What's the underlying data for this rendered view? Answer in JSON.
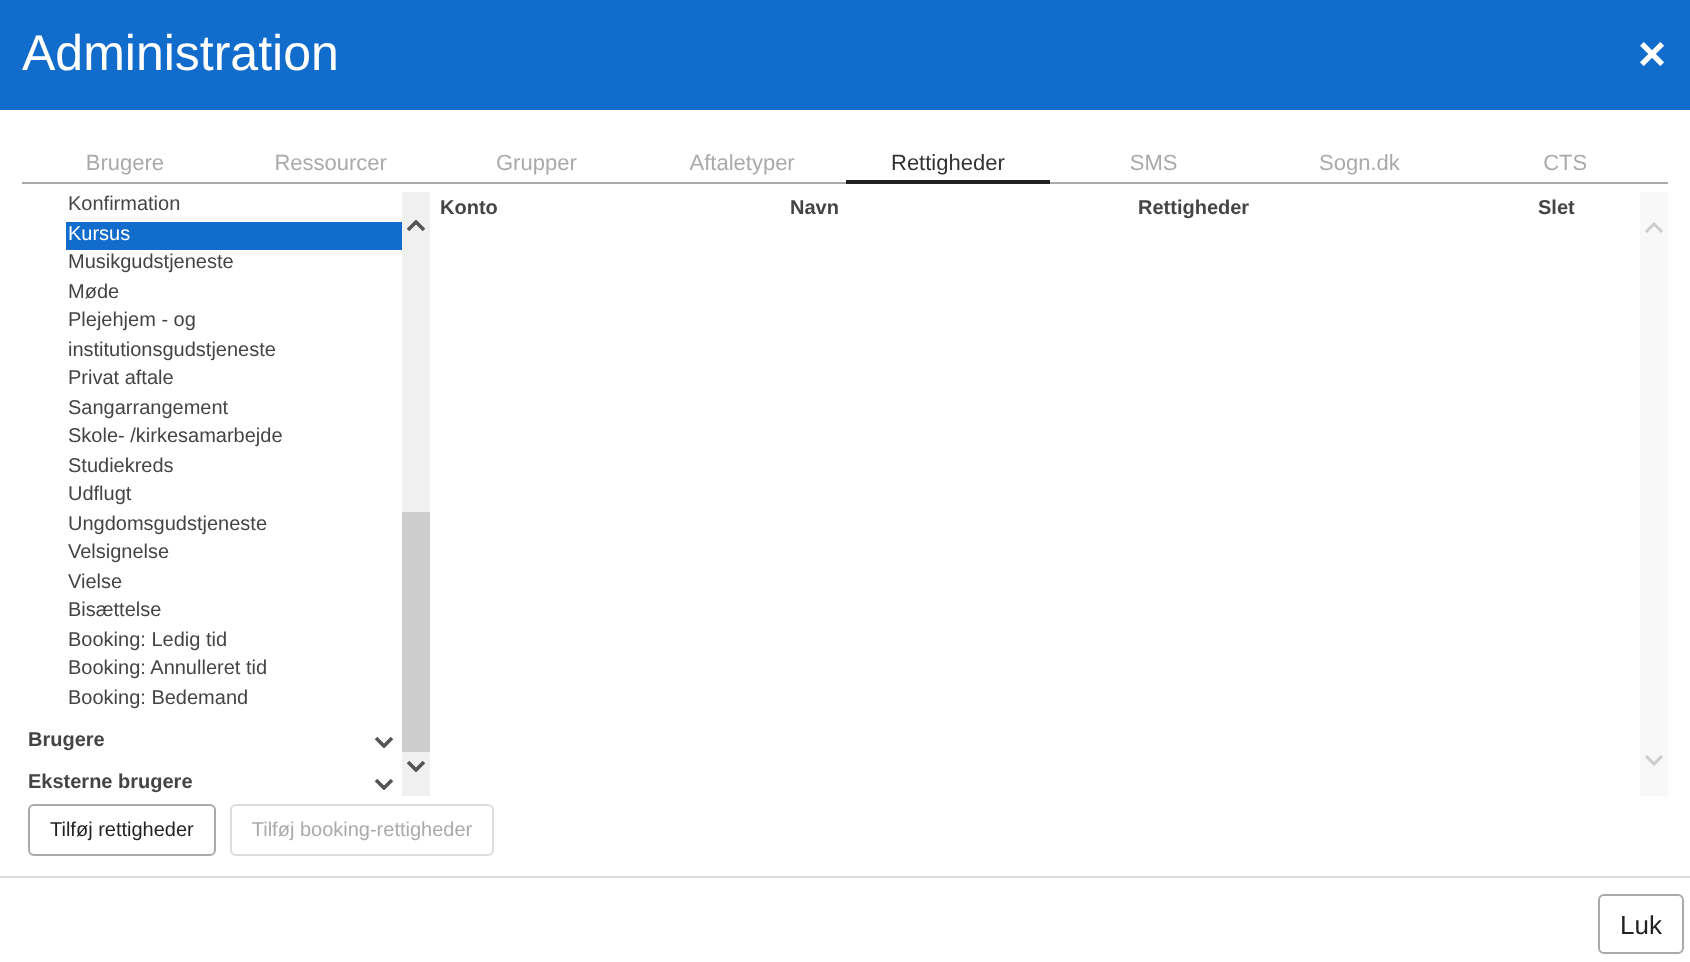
{
  "window": {
    "title": "Administration",
    "close": "×"
  },
  "tabs": [
    {
      "label": "Brugere",
      "selected": false
    },
    {
      "label": "Ressourcer",
      "selected": false
    },
    {
      "label": "Grupper",
      "selected": false
    },
    {
      "label": "Aftaletyper",
      "selected": false
    },
    {
      "label": "Rettigheder",
      "selected": true
    },
    {
      "label": "SMS",
      "selected": false
    },
    {
      "label": "Sogn.dk",
      "selected": false
    },
    {
      "label": "CTS",
      "selected": false
    }
  ],
  "sidebar": {
    "items": [
      {
        "label": "Konfirmation",
        "selected": false
      },
      {
        "label": "Kursus",
        "selected": true
      },
      {
        "label": "Musikgudstjeneste",
        "selected": false
      },
      {
        "label": "Møde",
        "selected": false
      },
      {
        "label": "Plejehjem - og institutionsgudstjeneste",
        "selected": false
      },
      {
        "label": "Privat aftale",
        "selected": false
      },
      {
        "label": "Sangarrangement",
        "selected": false
      },
      {
        "label": "Skole- /kirkesamarbejde",
        "selected": false
      },
      {
        "label": "Studiekreds",
        "selected": false
      },
      {
        "label": "Udflugt",
        "selected": false
      },
      {
        "label": "Ungdomsgudstjeneste",
        "selected": false
      },
      {
        "label": "Velsignelse",
        "selected": false
      },
      {
        "label": "Vielse",
        "selected": false
      },
      {
        "label": "Bisættelse",
        "selected": false
      },
      {
        "label": "Booking: Ledig tid",
        "selected": false
      },
      {
        "label": "Booking: Annulleret tid",
        "selected": false
      },
      {
        "label": "Booking: Bedemand",
        "selected": false
      }
    ],
    "groups": [
      {
        "label": "Brugere",
        "expanded": false
      },
      {
        "label": "Eksterne brugere",
        "expanded": false
      }
    ]
  },
  "table": {
    "columns": [
      "Konto",
      "Navn",
      "Rettigheder",
      "Slet"
    ]
  },
  "buttons": [
    {
      "label": "Tilføj rettigheder",
      "disabled": false
    },
    {
      "label": "Tilføj booking-rettigheder",
      "disabled": true
    }
  ],
  "footer_button": "Luk"
}
